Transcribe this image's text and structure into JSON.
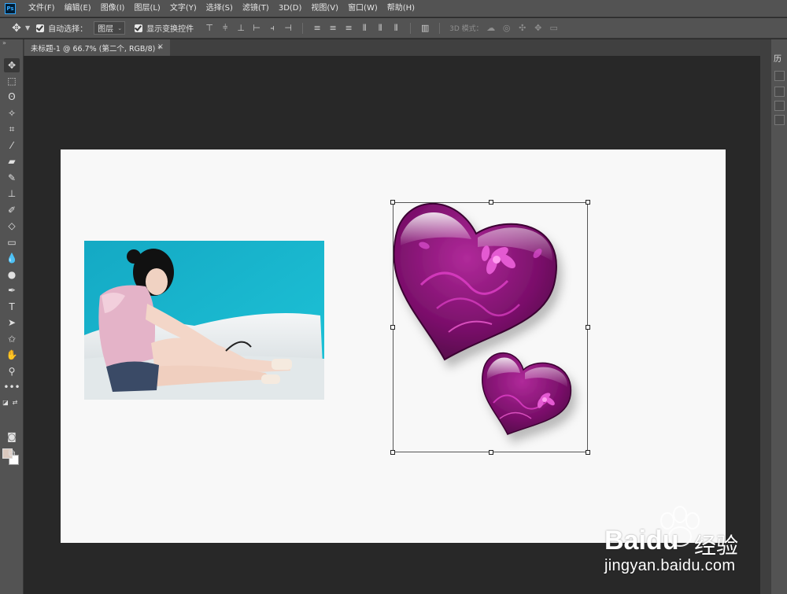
{
  "app": {
    "logo": "Ps"
  },
  "menu": [
    "文件(F)",
    "编辑(E)",
    "图像(I)",
    "图层(L)",
    "文字(Y)",
    "选择(S)",
    "滤镜(T)",
    "3D(D)",
    "视图(V)",
    "窗口(W)",
    "帮助(H)"
  ],
  "options": {
    "auto_select_label": "自动选择：",
    "auto_select_value": "图层",
    "show_transform_label": "显示变换控件",
    "mode_3d_label": "3D 模式："
  },
  "document": {
    "tab_title": "未标题-1 @ 66.7% (第二个, RGB/8) *",
    "close_glyph": "×"
  },
  "right_panel": {
    "label": "历"
  },
  "colors": {
    "foreground": "#d9c8be",
    "background": "#ffffff",
    "heart_dark": "#5a0a4a",
    "heart_mid": "#8a1a78",
    "heart_accent": "#e040c8"
  },
  "watermark": {
    "brand": "Bai",
    "brand_suffix": "du",
    "cn": "经验",
    "url": "jingyan.baidu.com"
  }
}
